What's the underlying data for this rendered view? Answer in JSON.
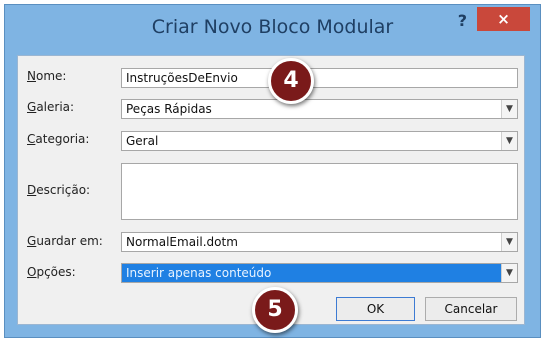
{
  "dialog": {
    "title": "Criar Novo Bloco Modular",
    "help_label": "?",
    "close_label": "×"
  },
  "fields": {
    "nome": {
      "label_key": "N",
      "label_rest": "ome:",
      "value": "InstruçõesDeEnvio"
    },
    "galeria": {
      "label_key": "G",
      "label_rest": "aleria:",
      "value": "Peças Rápidas"
    },
    "categoria": {
      "label_key": "C",
      "label_rest": "ategoria:",
      "value": "Geral"
    },
    "descricao": {
      "label_key": "D",
      "label_rest": "escrição:",
      "value": ""
    },
    "guardar_em": {
      "label_key": "G",
      "label_rest": "uardar em:",
      "value": "NormalEmail.dotm"
    },
    "opcoes": {
      "label_key": "O",
      "label_rest": "pções:",
      "value": "Inserir apenas conteúdo"
    }
  },
  "buttons": {
    "ok": "OK",
    "cancel": "Cancelar"
  },
  "callouts": {
    "step4": "4",
    "step5": "5"
  },
  "colors": {
    "frame": "#7fb4e3",
    "close": "#c9483b",
    "selection": "#1f80e3",
    "badge": "#7a1a1a"
  },
  "icons": {
    "dropdown": "chevron-down-icon"
  }
}
